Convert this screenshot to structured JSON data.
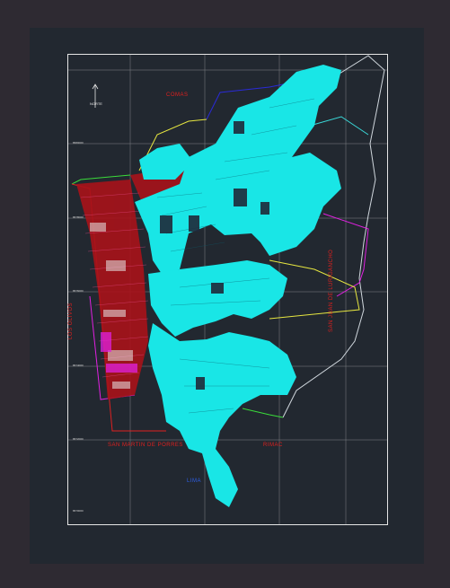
{
  "drawing": {
    "north_label": "NORTE",
    "district_labels": {
      "top": "COMAS",
      "left": "LOS OLIVOS",
      "bottom_left": "SAN MARTIN DE PORRES",
      "bottom_right": "RIMAC",
      "bottom_center": "LIMA",
      "right": "SAN JUAN DE LURIGANCHO"
    },
    "grid_coords": {
      "left_1": "8680000",
      "left_2": "8678000",
      "left_3": "8676000",
      "left_4": "8674000",
      "left_5": "8672000",
      "left_6": "8670000"
    }
  },
  "colors": {
    "background": "#2e2a32",
    "viewport": "#222830",
    "urban_cyan": "#19e6e6",
    "urban_red": "#b0121a",
    "border_magenta": "#e020e0",
    "border_yellow": "#e6e640",
    "border_green": "#3adc3a",
    "border_blue": "#2030c8",
    "label_red": "#e0201e"
  }
}
